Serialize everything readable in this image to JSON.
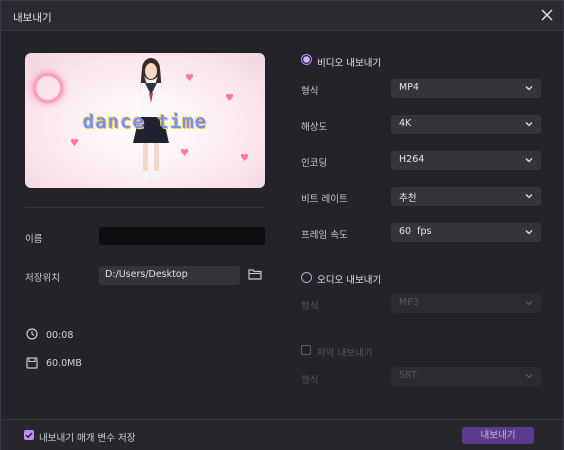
{
  "window": {
    "title": "내보내기"
  },
  "preview": {
    "overlay_text": "dance time"
  },
  "left": {
    "name_label": "이름",
    "name_value": "",
    "path_label": "저장위치",
    "path_value": "D:/Users/Desktop",
    "duration": "00:08",
    "filesize": "60.0MB"
  },
  "video_export": {
    "title": "비디오 내보내기",
    "selected": true,
    "rows": [
      {
        "label": "형식",
        "value": "MP4"
      },
      {
        "label": "해상도",
        "value": "4K"
      },
      {
        "label": "인코딩",
        "value": "H264"
      },
      {
        "label": "비트 레이트",
        "value": "추천"
      },
      {
        "label": "프레임 속도",
        "value": "60  fps"
      }
    ]
  },
  "audio_export": {
    "title": "오디오 내보내기",
    "selected": false,
    "format_label": "형식",
    "format_value": "MP3"
  },
  "subtitle_export": {
    "title": "자막 내보내기",
    "checked": false,
    "format_label": "형식",
    "format_value": "SRT"
  },
  "footer": {
    "save_params_label": "내보내기 매개 변수 저장",
    "save_params_checked": true,
    "export_button": "내보내기"
  },
  "colors": {
    "accent": "#b989ff",
    "button": "#5a3b8c",
    "background": "#232329"
  }
}
